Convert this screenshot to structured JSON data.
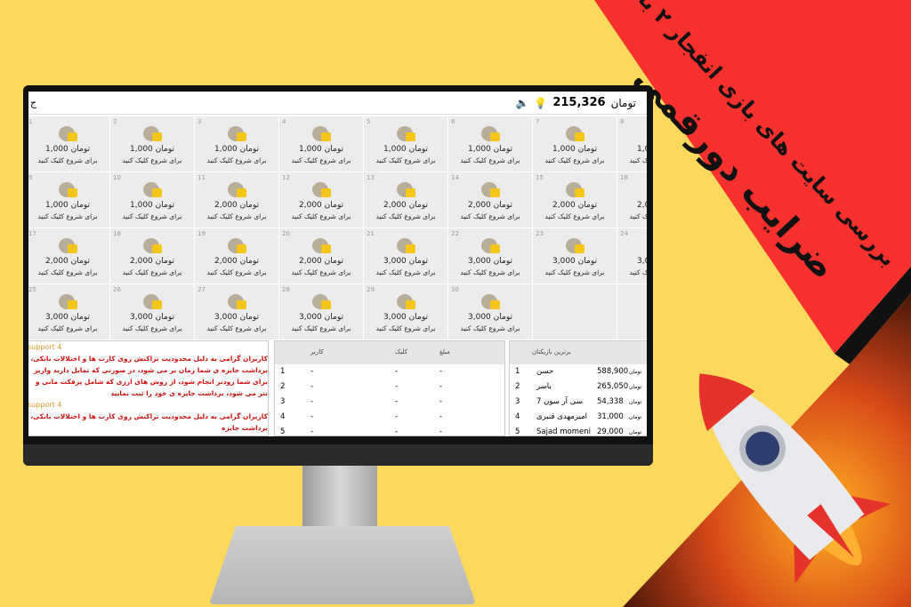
{
  "banner": {
    "line1": "بررسی سایت های بازی انفجار ۲ با",
    "line2": "ضرایب دورقمی"
  },
  "colors": {
    "background": "#fcd95c",
    "banner_red": "#f8312f",
    "cell": "#ececec",
    "message_red": "#d01010"
  },
  "topbar": {
    "balance": "215,326",
    "currency": "تومان",
    "left_text": "ج",
    "icons": [
      "speaker-icon",
      "lightbulb-icon"
    ]
  },
  "grid": {
    "currency": "تومان",
    "cta": "برای شروع کلیک کنید",
    "cells": [
      {
        "n": "1",
        "amount": "1,000"
      },
      {
        "n": "2",
        "amount": "1,000"
      },
      {
        "n": "3",
        "amount": "1,000"
      },
      {
        "n": "4",
        "amount": "1,000"
      },
      {
        "n": "5",
        "amount": "1,000"
      },
      {
        "n": "6",
        "amount": "1,000"
      },
      {
        "n": "7",
        "amount": "1,000"
      },
      {
        "n": "8",
        "amount": "1,000"
      },
      {
        "n": "9",
        "amount": "1,000"
      },
      {
        "n": "10",
        "amount": "1,000"
      },
      {
        "n": "11",
        "amount": "2,000"
      },
      {
        "n": "12",
        "amount": "2,000"
      },
      {
        "n": "13",
        "amount": "2,000"
      },
      {
        "n": "14",
        "amount": "2,000"
      },
      {
        "n": "15",
        "amount": "2,000"
      },
      {
        "n": "16",
        "amount": "2,000"
      },
      {
        "n": "17",
        "amount": "2,000"
      },
      {
        "n": "18",
        "amount": "2,000"
      },
      {
        "n": "19",
        "amount": "2,000"
      },
      {
        "n": "20",
        "amount": "2,000"
      },
      {
        "n": "21",
        "amount": "3,000"
      },
      {
        "n": "22",
        "amount": "3,000"
      },
      {
        "n": "23",
        "amount": "3,000"
      },
      {
        "n": "24",
        "amount": "3,000"
      },
      {
        "n": "25",
        "amount": "3,000"
      },
      {
        "n": "26",
        "amount": "3,000"
      },
      {
        "n": "27",
        "amount": "3,000"
      },
      {
        "n": "28",
        "amount": "3,000"
      },
      {
        "n": "29",
        "amount": "3,000"
      },
      {
        "n": "30",
        "amount": "3,000"
      }
    ]
  },
  "messages": [
    {
      "author": "support 4",
      "text": "کاربران گرامی به دلیل محدودیت تراکنش روی کارت ها و اختلالات بانکی، برداشت جایزه ی شما زمان بر می شود، در صورتی که تمایل دارید واریز برای شما زودتر انجام شود، از روش های ارزی که شامل پرفکت مانی و تتر می شود، برداشت جایزه ی خود را ثبت نمایید"
    },
    {
      "author": "support 4",
      "text": "کاربران گرامی به دلیل محدودیت تراکنش روی کارت ها و اختلالات بانکی، برداشت جایزه"
    }
  ],
  "current_table": {
    "headers": [
      "کاربر",
      "کلیک",
      "مبلغ"
    ],
    "rows": [
      [
        "1",
        "-",
        "-",
        "-"
      ],
      [
        "2",
        "-",
        "-",
        "-"
      ],
      [
        "3",
        "-",
        "-",
        "-"
      ],
      [
        "4",
        "-",
        "-",
        "-"
      ],
      [
        "5",
        "-",
        "-",
        "-"
      ]
    ]
  },
  "leaders": {
    "header": "برترین بازیکنان",
    "currency": "تومان",
    "rows": [
      {
        "rank": "1",
        "name": "حسن",
        "amount": "588,900"
      },
      {
        "rank": "2",
        "name": "یاسر",
        "amount": "265,050"
      },
      {
        "rank": "3",
        "name": "سی آر سون 7",
        "amount": "54,338"
      },
      {
        "rank": "4",
        "name": "امیرمهدی قنبری",
        "amount": "31,000"
      },
      {
        "rank": "5",
        "name": "Sajad momeni",
        "amount": "29,000"
      }
    ]
  }
}
